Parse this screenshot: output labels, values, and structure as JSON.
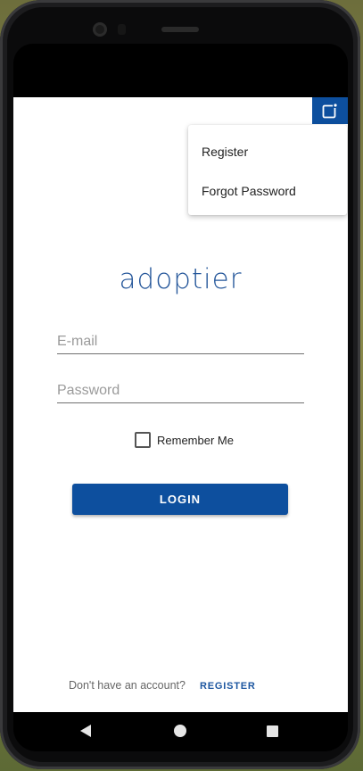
{
  "app": {
    "logo_text": "adoptier"
  },
  "colors": {
    "brand": "#0d4f9e",
    "logo": "#24569a"
  },
  "corner_action": {
    "icon": "open-in-new-window-icon"
  },
  "menu": {
    "items": [
      {
        "label": "Register"
      },
      {
        "label": "Forgot Password"
      }
    ]
  },
  "form": {
    "email_placeholder": "E-mail",
    "password_placeholder": "Password",
    "remember_label": "Remember Me",
    "remember_checked": false,
    "login_label": "LOGIN"
  },
  "footer": {
    "prompt": "Don't have an account?",
    "register_link": "REGISTER"
  },
  "navbar": {
    "icons": [
      "back-icon",
      "home-icon",
      "recent-apps-icon"
    ]
  }
}
